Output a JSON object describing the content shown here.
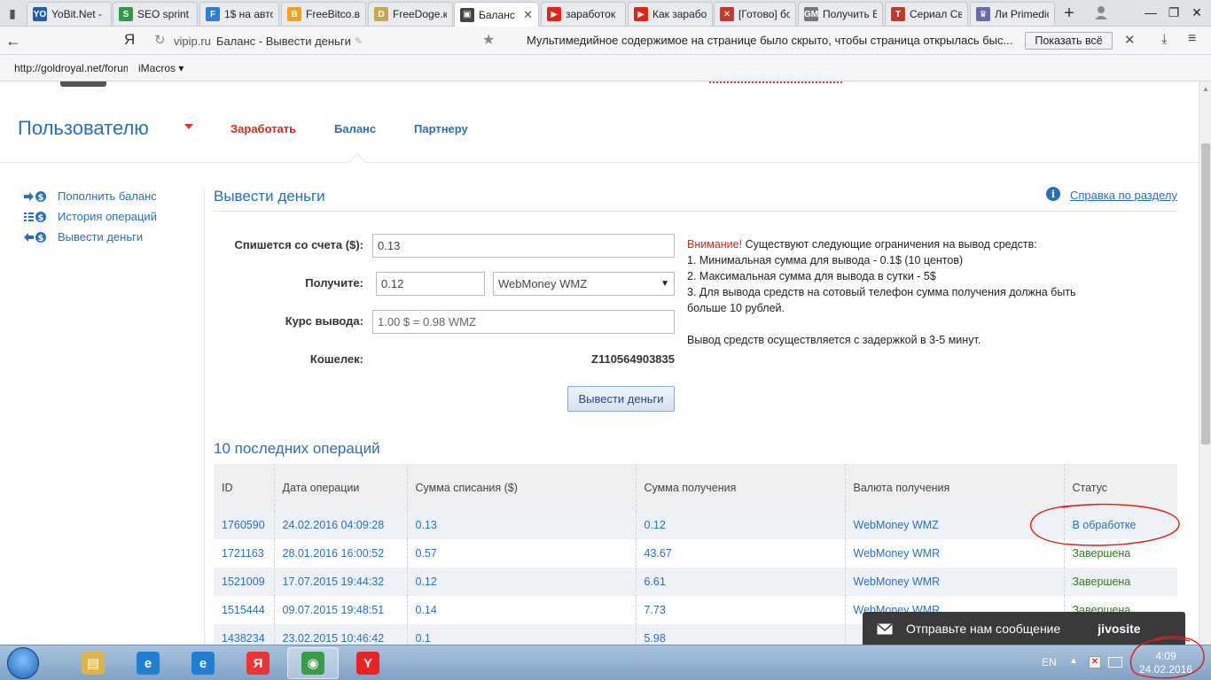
{
  "browser": {
    "tabs": [
      {
        "label": "YoBit.Net -",
        "fav": "YO",
        "color": "#1f5fa8"
      },
      {
        "label": "SEO sprint",
        "fav": "S",
        "color": "#2e9a45"
      },
      {
        "label": "1$ на автом",
        "fav": "F",
        "color": "#2d7fd0"
      },
      {
        "label": "FreeBitco.в",
        "fav": "B",
        "color": "#f0a21b"
      },
      {
        "label": "FreeDoge.к",
        "fav": "D",
        "color": "#c9a54b"
      },
      {
        "label": "Баланс",
        "fav": "▣",
        "color": "#444",
        "active": true
      },
      {
        "label": "заработок",
        "fav": "▶",
        "color": "#e62117"
      },
      {
        "label": "Как зарабо",
        "fav": "▶",
        "color": "#e62117"
      },
      {
        "label": "[Готово] бо",
        "fav": "✕",
        "color": "#c0392b"
      },
      {
        "label": "Получить В",
        "fav": "GM",
        "color": "#777"
      },
      {
        "label": "Сериал Све",
        "fav": "T",
        "color": "#c0392b"
      },
      {
        "label": "Ли Primedic",
        "fav": "♛",
        "color": "#6a6aa8"
      }
    ],
    "nav": {
      "yandex": "Я",
      "domain": "vipip.ru",
      "page_title": "Баланс - Вывести деньги",
      "notice": "Мультимедийное содержимое на странице было скрыто, чтобы страница открылась быс...",
      "show_all": "Показать всё"
    },
    "bookmarks": {
      "item1": "http://goldroyal.net/forum",
      "item2": "iMacros ▾"
    }
  },
  "site": {
    "menu_title": "Пользователю",
    "nav": {
      "earn": "Заработать",
      "balance": "Баланс",
      "partner": "Партнеру"
    },
    "sidebar": [
      {
        "label": "Пополнить баланс",
        "icon": "arrow-in-dollar-icon"
      },
      {
        "label": "История операций",
        "icon": "list-dollar-icon"
      },
      {
        "label": "Вывести деньги",
        "icon": "arrow-out-dollar-icon"
      }
    ],
    "content": {
      "title": "Вывести деньги",
      "help_link": "Справка по разделу",
      "help_glyph": "i"
    },
    "form": {
      "debit_label": "Спишется со счета ($):",
      "debit_value": "0.13",
      "receive_label": "Получите:",
      "receive_value": "0.12",
      "currency_selected": "WebMoney WMZ",
      "rate_label": "Курс вывода:",
      "rate_value": "1.00 $ = 0.98 WMZ",
      "wallet_label": "Кошелек:",
      "wallet_value": "Z110564903835",
      "submit": "Вывести деньги"
    },
    "notes": {
      "warn": "Внимание!",
      "intro": " Существуют следующие ограничения на вывод средств:",
      "line1": "1. Минимальная сумма для вывода - 0.1$ (10 центов)",
      "line2": "2. Максимальная сумма для вывода в сутки - 5$",
      "line3": "3. Для вывода средств на сотовый телефон сумма получения должна быть больше 10 рублей.",
      "line4": "Вывод средств осуществляется с задержкой в 3-5 минут."
    },
    "operations": {
      "title": "10 последних операций",
      "columns": [
        "ID",
        "Дата операции",
        "Сумма списания ($)",
        "Сумма получения",
        "Валюта получения",
        "Статус"
      ],
      "rows": [
        [
          "1760590",
          "24.02.2016 04:09:28",
          "0.13",
          "0.12",
          "WebMoney WMZ",
          "В обработке"
        ],
        [
          "1721163",
          "28.01.2016 16:00:52",
          "0.57",
          "43.67",
          "WebMoney WMR",
          "Завершена"
        ],
        [
          "1521009",
          "17.07.2015 19:44:32",
          "0.12",
          "6.61",
          "WebMoney WMR",
          "Завершена"
        ],
        [
          "1515444",
          "09.07.2015 19:48:51",
          "0.14",
          "7.73",
          "WebMoney WMR",
          "Завершена"
        ],
        [
          "1438234",
          "23.02.2015 10:46:42",
          "0.1",
          "5.98",
          "",
          ""
        ]
      ]
    },
    "chat": {
      "label": "Отправьте нам сообщение",
      "brand": "jivosite"
    }
  },
  "taskbar": {
    "lang": "EN",
    "time": "4:09",
    "date": "24.02.2016",
    "apps": [
      {
        "name": "explorer-icon",
        "glyph": "▤",
        "color": "#e0b34a"
      },
      {
        "name": "ie-icon",
        "glyph": "e",
        "color": "#1f7fd4"
      },
      {
        "name": "ie-icon-2",
        "glyph": "e",
        "color": "#1f7fd4"
      },
      {
        "name": "yandex-app-icon",
        "glyph": "Я",
        "color": "#e33"
      },
      {
        "name": "chrome-icon",
        "glyph": "◉",
        "color": "#3a9c47",
        "active": true
      },
      {
        "name": "yandex-browser-icon",
        "glyph": "Y",
        "color": "#e22"
      }
    ]
  }
}
